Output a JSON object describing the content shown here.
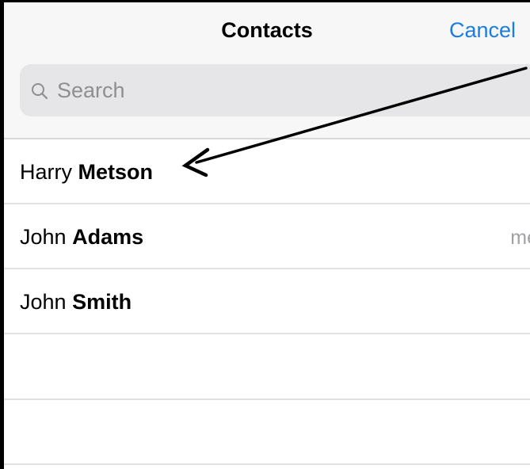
{
  "header": {
    "title": "Contacts",
    "cancel_label": "Cancel"
  },
  "search": {
    "placeholder": "Search",
    "icon": "search-icon"
  },
  "contacts": [
    {
      "first": "Harry",
      "last": "Metson",
      "detail": ""
    },
    {
      "first": "John",
      "last": "Adams",
      "detail": "me"
    },
    {
      "first": "John",
      "last": "Smith",
      "detail": ""
    }
  ],
  "colors": {
    "accent": "#1a7de0",
    "header_bg": "#f7f7f7",
    "search_bg": "#e6e6e8",
    "placeholder": "#8e8e93",
    "divider": "#e1e1e3"
  },
  "annotation": {
    "icon": "arrow-icon",
    "target": "Harry Metson"
  }
}
